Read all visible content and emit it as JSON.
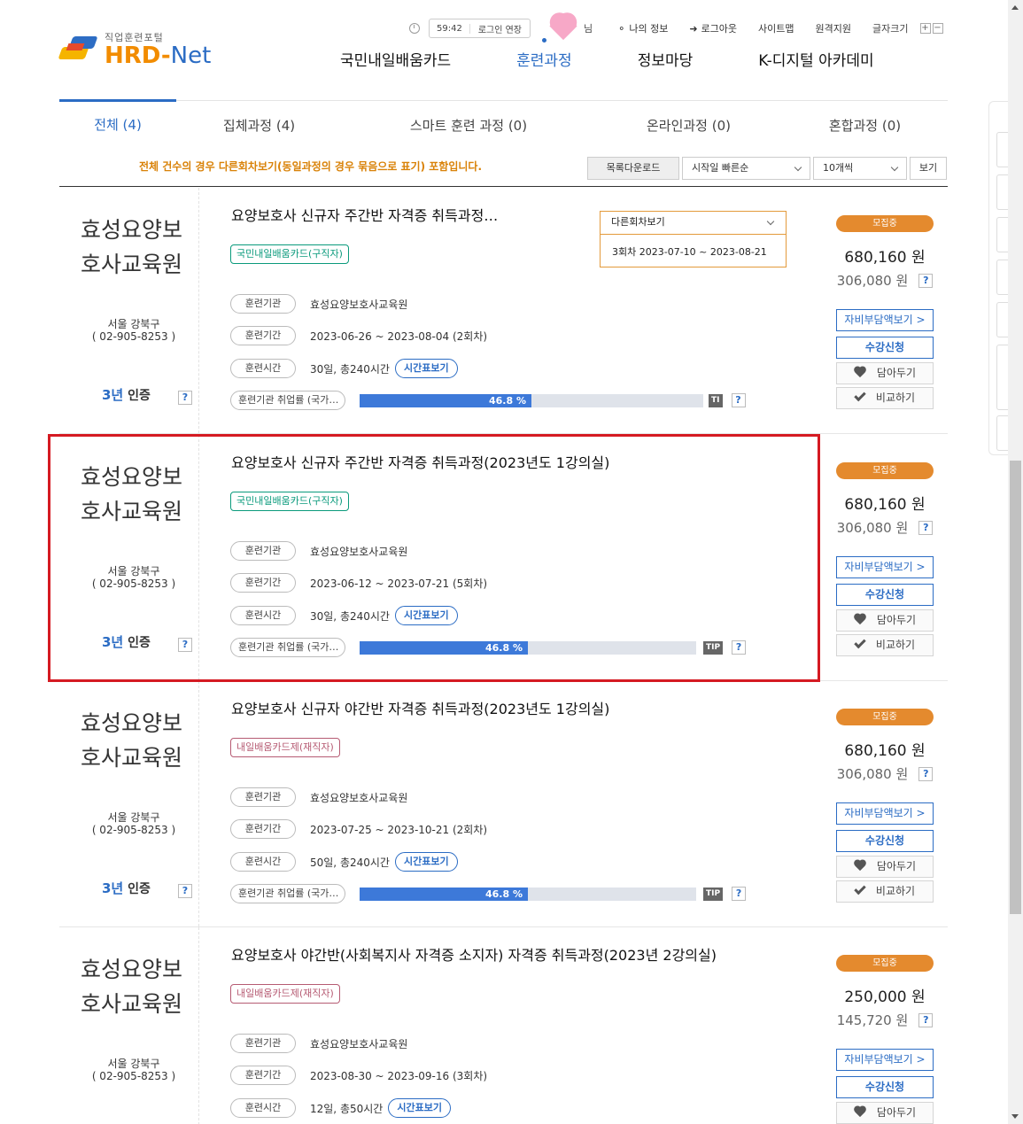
{
  "header": {
    "timer": "59:42",
    "login_extend": "로그인 연장",
    "greeting_suffix": "님",
    "links": [
      "나의 정보",
      "로그아웃",
      "사이트맵",
      "원격지원"
    ],
    "font_size_label": "글자크기",
    "font_plus": "+",
    "font_minus": "−",
    "logo_sub": "직업훈련포털",
    "logo_main_a": "HRD-",
    "logo_main_b": "Net",
    "nav": [
      "국민내일배움카드",
      "훈련과정",
      "정보마당",
      "K-디지털 아카데미"
    ],
    "nav_active": "훈련과정"
  },
  "tabs": [
    {
      "label": "전체 (4)",
      "active": true
    },
    {
      "label": "집체과정 (4)"
    },
    {
      "label": "스마트 훈련 과정 (0)"
    },
    {
      "label": "온라인과정 (0)"
    },
    {
      "label": "혼합과정 (0)"
    }
  ],
  "notice": "전체 건수의 경우 다른회차보기(동일과정의 경우 묶음으로 표기) 포함입니다.",
  "controls": {
    "download": "목록다운로드",
    "sort": "시작일 빠른순",
    "per_page": "10개씩",
    "view": "보기"
  },
  "labels": {
    "org": "훈련기관",
    "period": "훈련기간",
    "time": "훈련시간",
    "employment": "훈련기관 취업률 (국가…",
    "timetable": "시간표보기",
    "tip": "TIP",
    "status": "모집중",
    "self_pay": "자비부담액보기 >",
    "apply": "수강신청",
    "save": "담아두기",
    "compare": "비교하기",
    "cert_years": "3년",
    "cert_text": "인증",
    "help": "?"
  },
  "dropdown": {
    "label": "다른회차보기",
    "option": "3회차 2023-07-10 ~ 2023-08-21"
  },
  "courses": [
    {
      "inst_name": "효성요양보호사교육원",
      "inst_addr1": "서울 강북구",
      "inst_addr2": "( 02-905-8253 )",
      "title": "요양보호사 신규자 주간반 자격증 취득과정…",
      "card": "국민내일배움카드(구직자)",
      "card_color": "green",
      "org": "효성요양보호사교육원",
      "period": "2023-06-26 ~ 2023-08-04 (2회차)",
      "time": "30일, 총240시간",
      "rate": 46.8,
      "rate_label": "46.8 %",
      "tip_label": "TI",
      "price": "680,160 원",
      "self_price": "306,080 원"
    },
    {
      "inst_name": "효성요양보호사교육원",
      "inst_addr1": "서울 강북구",
      "inst_addr2": "( 02-905-8253 )",
      "title": "요양보호사 신규자 주간반 자격증 취득과정(2023년도 1강의실)",
      "card": "국민내일배움카드(구직자)",
      "card_color": "green",
      "org": "효성요양보호사교육원",
      "period": "2023-06-12 ~ 2023-07-21 (5회차)",
      "time": "30일, 총240시간",
      "rate": 46.8,
      "rate_label": "46.8 %",
      "tip_label": "TIP",
      "price": "680,160 원",
      "self_price": "306,080 원"
    },
    {
      "inst_name": "효성요양보호사교육원",
      "inst_addr1": "서울 강북구",
      "inst_addr2": "( 02-905-8253 )",
      "title": "요양보호사 신규자 야간반 자격증 취득과정(2023년도 1강의실)",
      "card": "내일배움카드제(재직자)",
      "card_color": "pink",
      "org": "효성요양보호사교육원",
      "period": "2023-07-25 ~ 2023-10-21 (2회차)",
      "time": "50일, 총240시간",
      "rate": 46.8,
      "rate_label": "46.8 %",
      "tip_label": "TIP",
      "price": "680,160 원",
      "self_price": "306,080 원"
    },
    {
      "inst_name": "효성요양보호사교육원",
      "inst_addr1": "서울 강북구",
      "inst_addr2": "( 02-905-8253 )",
      "title": "요양보호사 야간반(사회복지사 자격증 소지자) 자격증 취득과정(2023년 2강의실)",
      "card": "내일배움카드제(재직자)",
      "card_color": "pink",
      "org": "효성요양보호사교육원",
      "period": "2023-08-30 ~ 2023-09-16 (3회차)",
      "time": "12일, 총50시간",
      "price": "250,000 원",
      "self_price": "145,720 원"
    }
  ]
}
